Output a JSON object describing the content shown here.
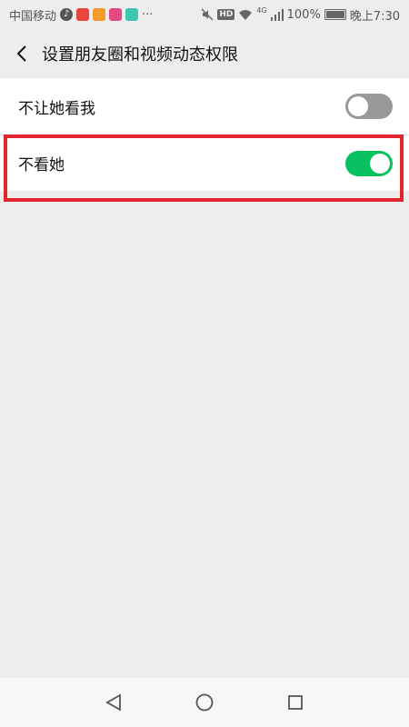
{
  "status_bar": {
    "carrier": "中国移动",
    "more": "···",
    "network": "4G",
    "battery": "100%",
    "time": "晚上7:30",
    "hd": "HD"
  },
  "header": {
    "title": "设置朋友圈和视频动态权限"
  },
  "settings": [
    {
      "label": "不让她看我",
      "enabled": false
    },
    {
      "label": "不看她",
      "enabled": true
    }
  ],
  "colors": {
    "toggle_on": "#07c160",
    "toggle_off": "#999999",
    "highlight": "#e3262e",
    "background": "#ededed"
  }
}
